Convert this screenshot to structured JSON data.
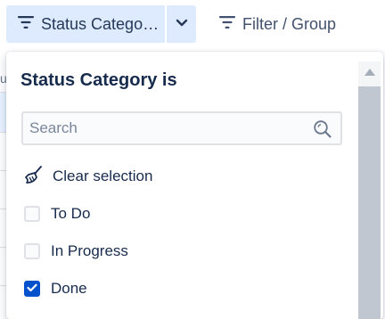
{
  "toolbar": {
    "status_filter_label": "Status Catego…",
    "filter_group_label": "Filter / Group"
  },
  "dropdown": {
    "title": "Status Category is",
    "search_placeholder": "Search",
    "clear_label": "Clear selection",
    "options": [
      {
        "label": "To Do",
        "checked": false
      },
      {
        "label": "In Progress",
        "checked": false
      },
      {
        "label": "Done",
        "checked": true
      }
    ]
  },
  "background": {
    "partial_glyph": "u"
  },
  "colors": {
    "accent": "#0052cc",
    "button_bg": "#deebff",
    "text": "#172b4d"
  }
}
